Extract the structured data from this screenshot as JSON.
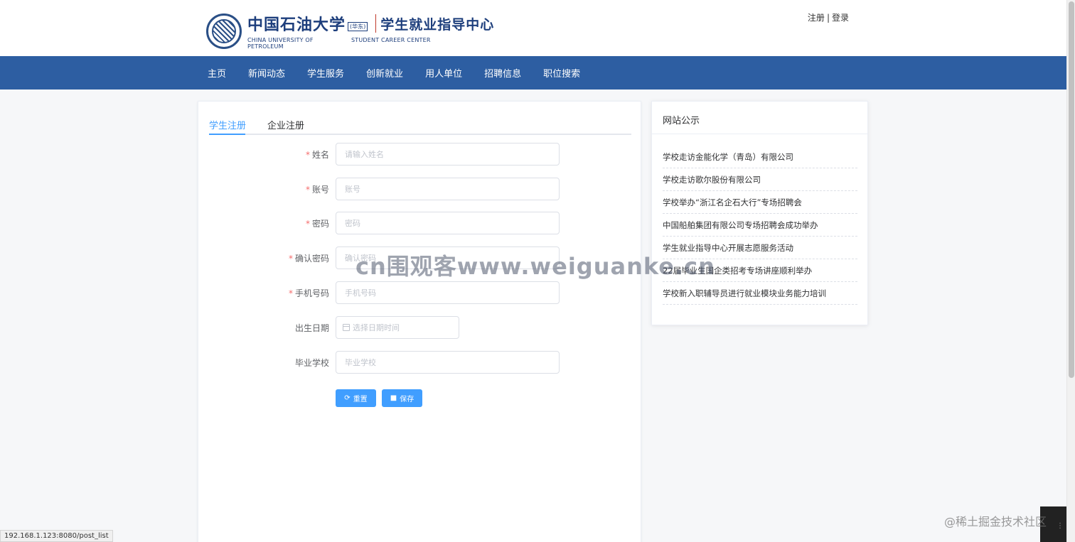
{
  "header": {
    "logo": {
      "name_cn": "中国石油大学",
      "campus_tag": "(华东)",
      "center_cn": "学生就业指导中心",
      "name_en": "CHINA UNIVERSITY OF PETROLEUM",
      "center_en": "STUDENT CAREER CENTER"
    },
    "links": {
      "register": "注册",
      "separator": "|",
      "login": "登录"
    }
  },
  "nav": {
    "items": [
      {
        "label": "主页"
      },
      {
        "label": "新闻动态"
      },
      {
        "label": "学生服务"
      },
      {
        "label": "创新就业"
      },
      {
        "label": "用人单位"
      },
      {
        "label": "招聘信息"
      },
      {
        "label": "职位搜索"
      }
    ]
  },
  "register_form": {
    "tabs": [
      {
        "label": "学生注册",
        "active": true
      },
      {
        "label": "企业注册",
        "active": false
      }
    ],
    "fields": [
      {
        "label": "姓名",
        "required": true,
        "placeholder": "请输入姓名"
      },
      {
        "label": "账号",
        "required": true,
        "placeholder": "账号"
      },
      {
        "label": "密码",
        "required": true,
        "placeholder": "密码"
      },
      {
        "label": "确认密码",
        "required": true,
        "placeholder": "确认密码"
      },
      {
        "label": "手机号码",
        "required": true,
        "placeholder": "手机号码"
      },
      {
        "label": "出生日期",
        "required": false,
        "placeholder": "选择日期时间"
      },
      {
        "label": "毕业学校",
        "required": false,
        "placeholder": "毕业学校"
      }
    ],
    "required_mark": "*",
    "buttons": {
      "reset": "重置",
      "save": "保存"
    }
  },
  "sidebar": {
    "title": "网站公示",
    "notices": [
      "学校走访金能化学（青岛）有限公司",
      "学校走访歌尔股份有限公司",
      "学校举办“浙江名企石大行”专场招聘会",
      "中国船舶集团有限公司专场招聘会成功举办",
      "学生就业指导中心开展志愿服务活动",
      "22届毕业生国企类招考专场讲座顺利举办",
      "学校新入职辅导员进行就业模块业务能力培训"
    ]
  },
  "overlays": {
    "watermark": "cn围观客www.weiguanke.cn",
    "status_url": "192.168.1.123:8080/post_list",
    "corner_credit": "@稀土掘金技术社区"
  },
  "colors": {
    "nav_bg": "#2d5ea2",
    "primary": "#409eff",
    "required": "#f56c6c",
    "brand_text": "#1d3e7c"
  }
}
